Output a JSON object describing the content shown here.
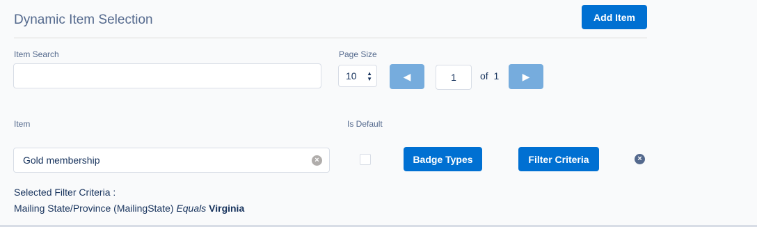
{
  "header": {
    "title": "Dynamic Item Selection",
    "add_item_label": "Add Item"
  },
  "search": {
    "label": "Item Search",
    "value": ""
  },
  "pagination": {
    "page_size_label": "Page Size",
    "page_size_value": "10",
    "current_page": "1",
    "of_label": "of",
    "total_pages": "1"
  },
  "columns": {
    "item_label": "Item",
    "is_default_label": "Is Default"
  },
  "row": {
    "item_value": "Gold membership",
    "is_default": false,
    "badge_types_label": "Badge Types",
    "filter_criteria_label": "Filter Criteria"
  },
  "selected_filter": {
    "label": "Selected Filter Criteria :",
    "field": "Mailing State/Province (MailingState)",
    "operator": "Equals",
    "value": "Virginia"
  },
  "colors": {
    "brand": "#0070d2",
    "brand_disabled": "#6fa8dc",
    "text": "#16325c",
    "label": "#54698d"
  }
}
